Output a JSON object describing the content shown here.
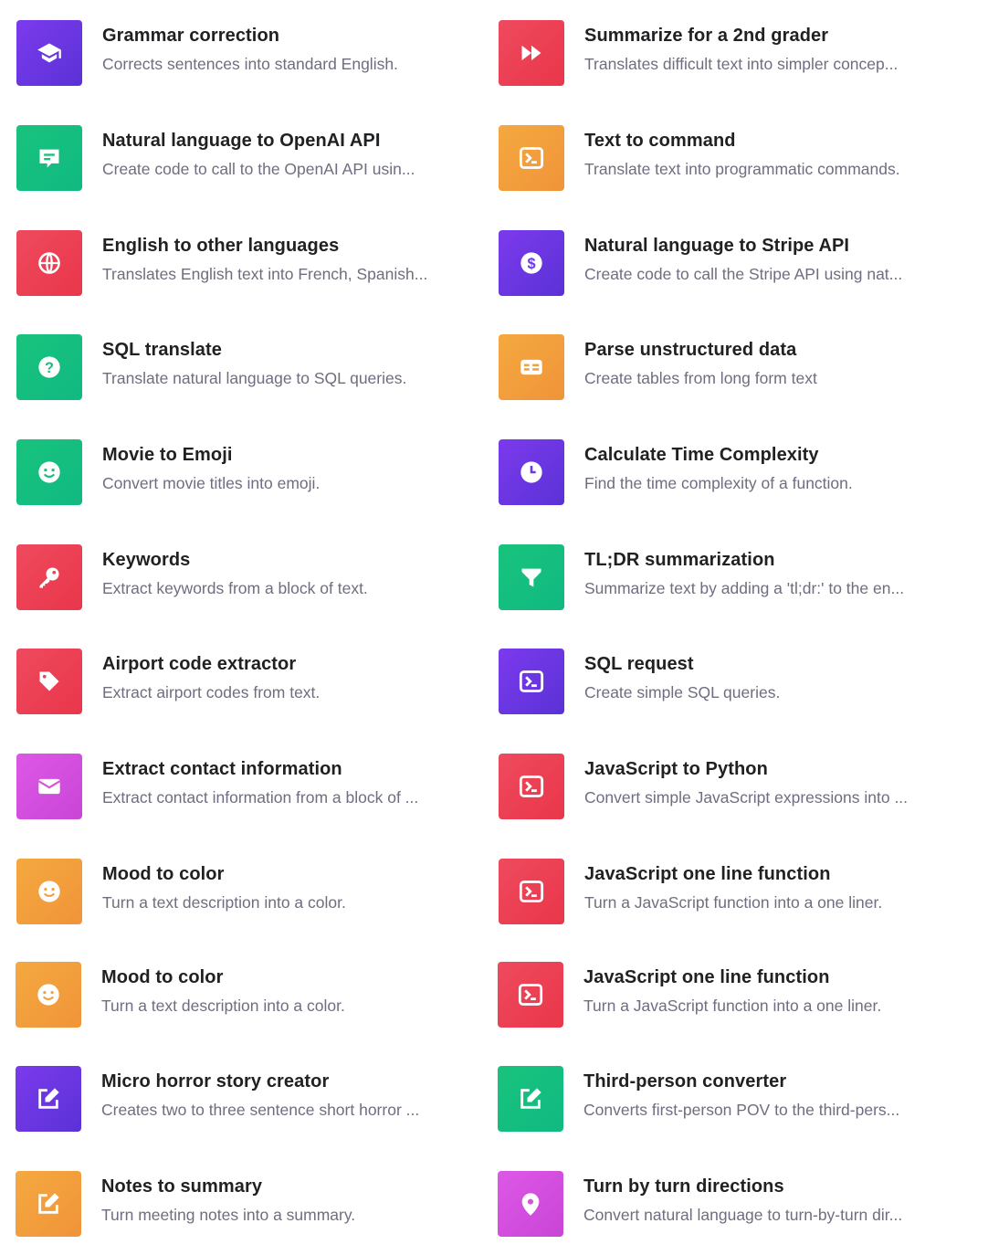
{
  "examples": [
    {
      "title": "Grammar correction",
      "description": "Corrects sentences into standard English.",
      "color": "#6b38e8",
      "icon": "graduation-cap-icon"
    },
    {
      "title": "Summarize for a 2nd grader",
      "description": "Translates difficult text into simpler concep...",
      "color": "#ee4257",
      "icon": "fast-forward-icon"
    },
    {
      "title": "Natural language to OpenAI API",
      "description": "Create code to call to the OpenAI API usin...",
      "color": "#16bf7b",
      "icon": "chat-bubble-icon"
    },
    {
      "title": "Text to command",
      "description": "Translate text into programmatic commands.",
      "color": "#f3a13d",
      "icon": "terminal-icon"
    },
    {
      "title": "English to other languages",
      "description": "Translates English text into French, Spanish...",
      "color": "#ee4257",
      "icon": "globe-icon"
    },
    {
      "title": "Natural language to Stripe API",
      "description": "Create code to call the Stripe API using nat...",
      "color": "#6b38e8",
      "icon": "dollar-icon"
    },
    {
      "title": "SQL translate",
      "description": "Translate natural language to SQL queries.",
      "color": "#16bf7b",
      "icon": "question-icon"
    },
    {
      "title": "Parse unstructured data",
      "description": "Create tables from long form text",
      "color": "#f3a13d",
      "icon": "table-icon"
    },
    {
      "title": "Movie to Emoji",
      "description": "Convert movie titles into emoji.",
      "color": "#16bf7b",
      "icon": "smiley-icon"
    },
    {
      "title": "Calculate Time Complexity",
      "description": "Find the time complexity of a function.",
      "color": "#6b38e8",
      "icon": "clock-icon"
    },
    {
      "title": "Keywords",
      "description": "Extract keywords from a block of text.",
      "color": "#ee4257",
      "icon": "key-icon"
    },
    {
      "title": "TL;DR summarization",
      "description": "Summarize text by adding a 'tl;dr:' to the en...",
      "color": "#16bf7b",
      "icon": "funnel-icon"
    },
    {
      "title": "Airport code extractor",
      "description": "Extract airport codes from text.",
      "color": "#ee4257",
      "icon": "tag-icon"
    },
    {
      "title": "SQL request",
      "description": "Create simple SQL queries.",
      "color": "#6b38e8",
      "icon": "terminal-icon"
    },
    {
      "title": "Extract contact information",
      "description": "Extract contact information from a block of ...",
      "color": "#d651e0",
      "icon": "envelope-icon"
    },
    {
      "title": "JavaScript to Python",
      "description": "Convert simple JavaScript expressions into ...",
      "color": "#ee4257",
      "icon": "terminal-icon"
    },
    {
      "title": "Mood to color",
      "description": "Turn a text description into a color.",
      "color": "#f3a13d",
      "icon": "smiley-icon"
    },
    {
      "title": "JavaScript one line function",
      "description": "Turn a JavaScript function into a one liner.",
      "color": "#ee4257",
      "icon": "terminal-icon"
    },
    {
      "title": "Mood to color",
      "description": "Turn a text description into a color.",
      "color": "#f3a13d",
      "icon": "smiley-icon"
    },
    {
      "title": "JavaScript one line function",
      "description": "Turn a JavaScript function into a one liner.",
      "color": "#ee4257",
      "icon": "terminal-icon"
    },
    {
      "title": "Micro horror story creator",
      "description": "Creates two to three sentence short horror ...",
      "color": "#6b38e8",
      "icon": "edit-icon"
    },
    {
      "title": "Third-person converter",
      "description": "Converts first-person POV to the third-pers...",
      "color": "#16bf7b",
      "icon": "edit-icon"
    },
    {
      "title": "Notes to summary",
      "description": "Turn meeting notes into a summary.",
      "color": "#f3a13d",
      "icon": "edit-icon"
    },
    {
      "title": "Turn by turn directions",
      "description": "Convert natural language to turn-by-turn dir...",
      "color": "#d651e0",
      "icon": "map-pin-icon"
    }
  ]
}
